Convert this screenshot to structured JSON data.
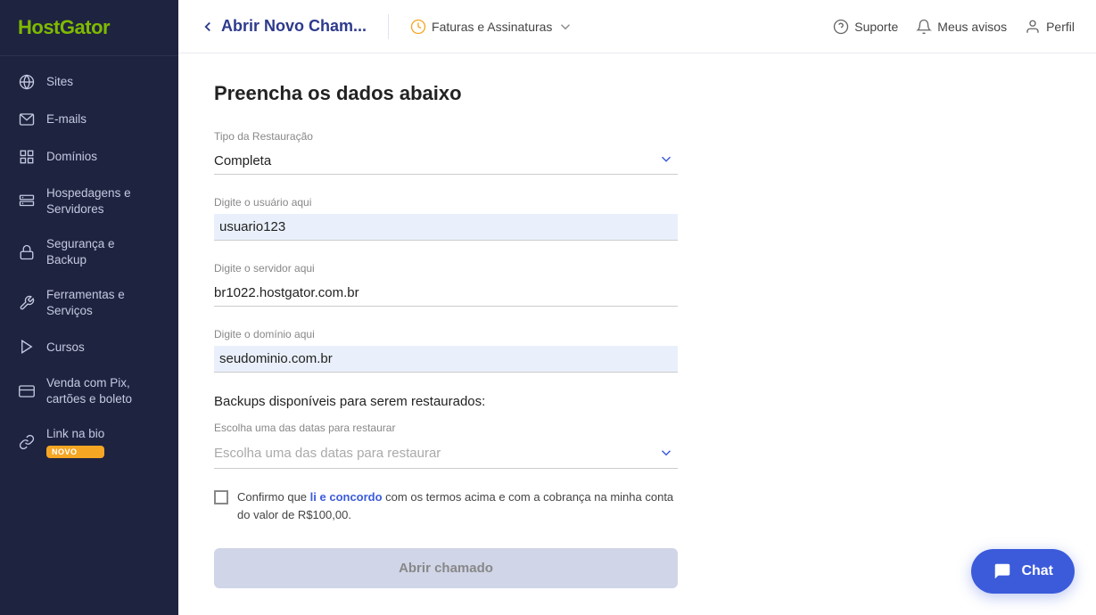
{
  "brand": {
    "name_part1": "Host",
    "name_part2": "Gator"
  },
  "sidebar": {
    "items": [
      {
        "id": "sites",
        "label": "Sites",
        "icon": "globe"
      },
      {
        "id": "emails",
        "label": "E-mails",
        "icon": "mail"
      },
      {
        "id": "domains",
        "label": "Domínios",
        "icon": "layout"
      },
      {
        "id": "hosting",
        "label": "Hospedagens e\nServidores",
        "icon": "server"
      },
      {
        "id": "security",
        "label": "Segurança e\nBackup",
        "icon": "lock"
      },
      {
        "id": "tools",
        "label": "Ferramentas e\nServiços",
        "icon": "tool"
      },
      {
        "id": "courses",
        "label": "Cursos",
        "icon": "play"
      },
      {
        "id": "pix",
        "label": "Venda com Pix,\ncartões e boleto",
        "icon": "creditcard",
        "badge": null
      },
      {
        "id": "linkbio",
        "label": "Link na bio",
        "icon": "link",
        "badge": "NOVO"
      }
    ]
  },
  "topnav": {
    "back_arrow": "←",
    "title": "Abrir Novo Cham...",
    "billing_label": "Faturas e Assinaturas",
    "support_label": "Suporte",
    "notifications_label": "Meus avisos",
    "profile_label": "Perfil"
  },
  "form": {
    "page_title": "Preencha os dados abaixo",
    "tipo_label": "Tipo da Restauração",
    "tipo_value": "Completa",
    "usuario_label": "Digite o usuário aqui",
    "usuario_value": "usuario123",
    "servidor_label": "Digite o servidor aqui",
    "servidor_value": "br1022.hostgator.com.br",
    "dominio_label": "Digite o domínio aqui",
    "dominio_value": "seudominio.com.br",
    "backups_title": "Backups disponíveis para serem restaurados:",
    "date_label": "Escolha uma das datas para restaurar",
    "date_placeholder": "Escolha uma das datas para restaurar",
    "terms_text_before": "Confirmo que ",
    "terms_link": "li e concordo",
    "terms_text_after": " com os termos acima e com a cobrança na minha conta do valor de R$100,00.",
    "submit_label": "Abrir chamado"
  },
  "chat": {
    "label": "Chat"
  }
}
